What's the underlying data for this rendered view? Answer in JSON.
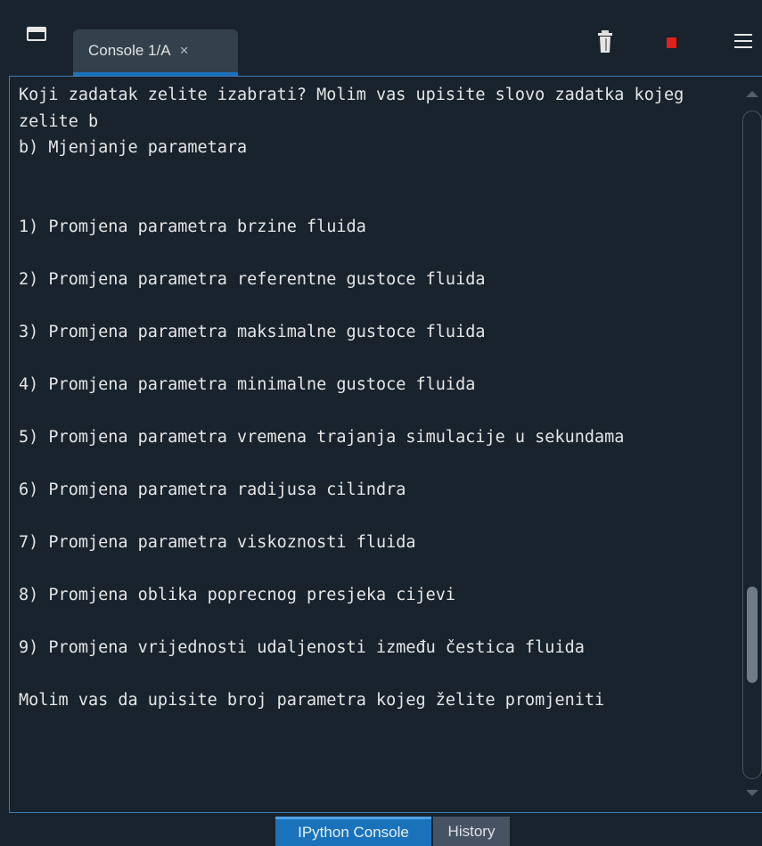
{
  "pane": {
    "tab_label": "Console 1/A",
    "tab_close": "×"
  },
  "toolbar": {
    "icons": [
      "undock-icon",
      "trash-icon",
      "stop-icon",
      "menu-icon"
    ],
    "stop_color": "#e0201b"
  },
  "console": {
    "output": "Koji zadatak zelite izabrati? Molim vas upisite slovo zadatka kojeg zelite b\nb) Mjenjanje parametara\n\n\n1) Promjena parametra brzine fluida\n\n2) Promjena parametra referentne gustoce fluida\n\n3) Promjena parametra maksimalne gustoce fluida\n\n4) Promjena parametra minimalne gustoce fluida\n\n5) Promjena parametra vremena trajanja simulacije u sekundama\n\n6) Promjena parametra radijusa cilindra\n\n7) Promjena parametra viskoznosti fluida\n\n8) Promjena oblika poprecnog presjeka cijevi\n\n9) Promjena vrijednosti udaljenosti između čestica fluida\n\nMolim vas da upisite broj parametra kojeg želite promjeniti"
  },
  "bottom_tabs": [
    {
      "label": "IPython Console",
      "active": true
    },
    {
      "label": "History",
      "active": false
    }
  ],
  "colors": {
    "background": "#19232d",
    "accent": "#1a72bb",
    "text": "#e6e6e6"
  }
}
